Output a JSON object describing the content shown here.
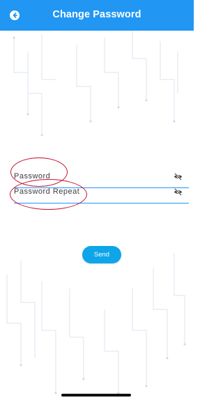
{
  "header": {
    "title": "Change Password",
    "back_icon": "back-arrow-icon"
  },
  "form": {
    "password_placeholder": "Password",
    "password_repeat_placeholder": "Password Repeat",
    "visibility_icon": "eye-off-icon"
  },
  "actions": {
    "send_label": "Send"
  },
  "colors": {
    "primary": "#2196f3",
    "button": "#0ea5e9",
    "annotation": "#c8102e"
  }
}
